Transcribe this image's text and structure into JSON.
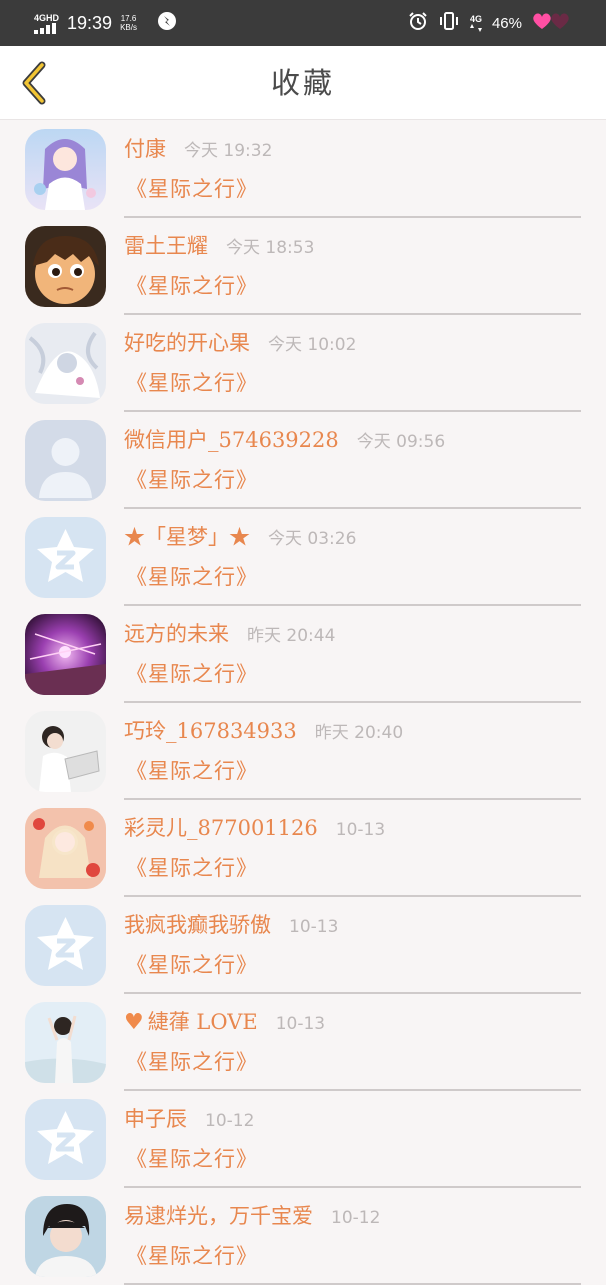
{
  "status_bar": {
    "network_label": "4GHD",
    "time": "19:39",
    "speed_value": "17.6",
    "speed_unit": "KB/s",
    "right_network": "4G",
    "battery": "46%"
  },
  "header": {
    "title": "收藏"
  },
  "items": [
    {
      "nick": "付康",
      "time": "今天 19:32",
      "book": "《星际之行》",
      "avatar": "anime-girl"
    },
    {
      "nick": "雷土王耀",
      "time": "今天 18:53",
      "book": "《星际之行》",
      "avatar": "cartoon-boy"
    },
    {
      "nick": "好吃的开心果",
      "time": "今天 10:02",
      "book": "《星际之行》",
      "avatar": "white-fantasy"
    },
    {
      "nick": "微信用户_574639228",
      "time": "今天 09:56",
      "book": "《星际之行》",
      "avatar": "default-person"
    },
    {
      "nick": "★「星梦」★",
      "time": "今天 03:26",
      "book": "《星际之行》",
      "avatar": "qq-default"
    },
    {
      "nick": "远方的未来",
      "time": "昨天 20:44",
      "book": "《星际之行》",
      "avatar": "purple-scene"
    },
    {
      "nick": "巧玲_167834933",
      "time": "昨天 20:40",
      "book": "《星际之行》",
      "avatar": "girl-book"
    },
    {
      "nick": "彩灵儿_877001126",
      "time": "10-13",
      "book": "《星际之行》",
      "avatar": "anime-red"
    },
    {
      "nick": "我疯我癫我骄傲",
      "time": "10-13",
      "book": "《星际之行》",
      "avatar": "qq-default"
    },
    {
      "nick": "ღ 緁葎 LOVE",
      "time": "10-13",
      "book": "《星际之行》",
      "avatar": "girl-sky",
      "heart": true
    },
    {
      "nick": "申子辰",
      "time": "10-12",
      "book": "《星际之行》",
      "avatar": "qq-default"
    },
    {
      "nick": "易逮烊光，万千宝爱",
      "time": "10-12",
      "book": "《星际之行》",
      "avatar": "man-portrait"
    }
  ]
}
